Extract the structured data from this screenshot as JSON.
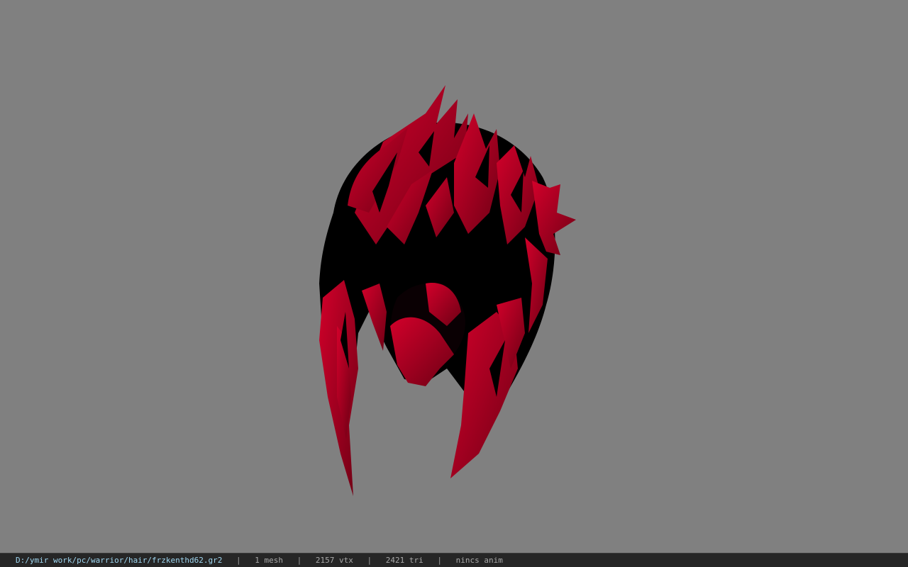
{
  "viewer": {
    "background_color": "#808080",
    "model_icon": "hair-mesh-icon",
    "hair_color": "#b0001e",
    "shadow_color": "#000000"
  },
  "statusbar": {
    "file_path": "D:/ymir work/pc/warrior/hair/frzkenthd62.gr2",
    "separator": "|",
    "mesh_count": "1 mesh",
    "vertex_count": "2157 vtx",
    "triangle_count": "2421 tri",
    "anim_status": "nincs anim"
  }
}
